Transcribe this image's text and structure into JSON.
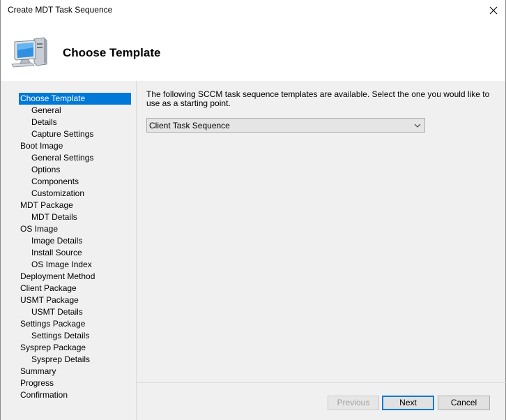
{
  "window": {
    "title": "Create MDT Task Sequence"
  },
  "header": {
    "title": "Choose Template",
    "icon": "computer-icon"
  },
  "nav": {
    "items": [
      {
        "label": "Choose Template",
        "level": 1,
        "active": true
      },
      {
        "label": "General",
        "level": 2
      },
      {
        "label": "Details",
        "level": 2
      },
      {
        "label": "Capture Settings",
        "level": 2
      },
      {
        "label": "Boot Image",
        "level": 1
      },
      {
        "label": "General Settings",
        "level": 2
      },
      {
        "label": "Options",
        "level": 2
      },
      {
        "label": "Components",
        "level": 2
      },
      {
        "label": "Customization",
        "level": 2
      },
      {
        "label": "MDT Package",
        "level": 1
      },
      {
        "label": "MDT Details",
        "level": 2
      },
      {
        "label": "OS Image",
        "level": 1
      },
      {
        "label": "Image Details",
        "level": 2
      },
      {
        "label": "Install Source",
        "level": 2
      },
      {
        "label": "OS Image Index",
        "level": 2
      },
      {
        "label": "Deployment Method",
        "level": 1
      },
      {
        "label": "Client Package",
        "level": 1
      },
      {
        "label": "USMT Package",
        "level": 1
      },
      {
        "label": "USMT Details",
        "level": 2
      },
      {
        "label": "Settings Package",
        "level": 1
      },
      {
        "label": "Settings Details",
        "level": 2
      },
      {
        "label": "Sysprep Package",
        "level": 1
      },
      {
        "label": "Sysprep Details",
        "level": 2
      },
      {
        "label": "Summary",
        "level": 1
      },
      {
        "label": "Progress",
        "level": 1
      },
      {
        "label": "Confirmation",
        "level": 1
      }
    ]
  },
  "content": {
    "description": "The following SCCM task sequence templates are available.  Select the one you would like to use as a starting point.",
    "template_select": {
      "value": "Client Task Sequence"
    }
  },
  "buttons": {
    "previous": "Previous",
    "next": "Next",
    "cancel": "Cancel"
  },
  "colors": {
    "accent": "#0078d7",
    "panel": "#f0f0f0",
    "disabled_text": "#a0a0a0"
  }
}
